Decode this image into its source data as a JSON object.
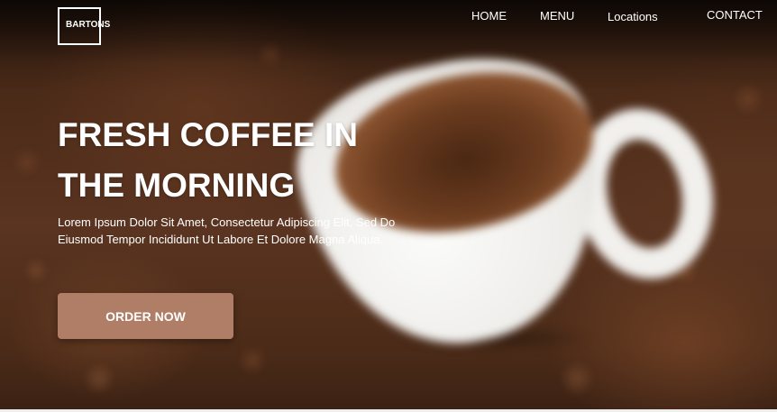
{
  "brand": {
    "logo_text": "BARTONS"
  },
  "nav": {
    "home": "HOME",
    "menu": "MENU",
    "locations": "Locations",
    "contact": "CONTACT"
  },
  "hero": {
    "headline_line1": "FRESH COFFEE IN",
    "headline_line2": "THE MORNING",
    "subtext": "Lorem Ipsum Dolor Sit Amet, Consectetur Adipiscing Elit, Sed Do Eiusmod Tempor Incididunt Ut Labore Et Dolore Magna Aliqua.",
    "cta_label": "ORDER NOW"
  },
  "colors": {
    "cta_background": "#b07d66",
    "text": "#ffffff",
    "background": "#4a2a18"
  }
}
